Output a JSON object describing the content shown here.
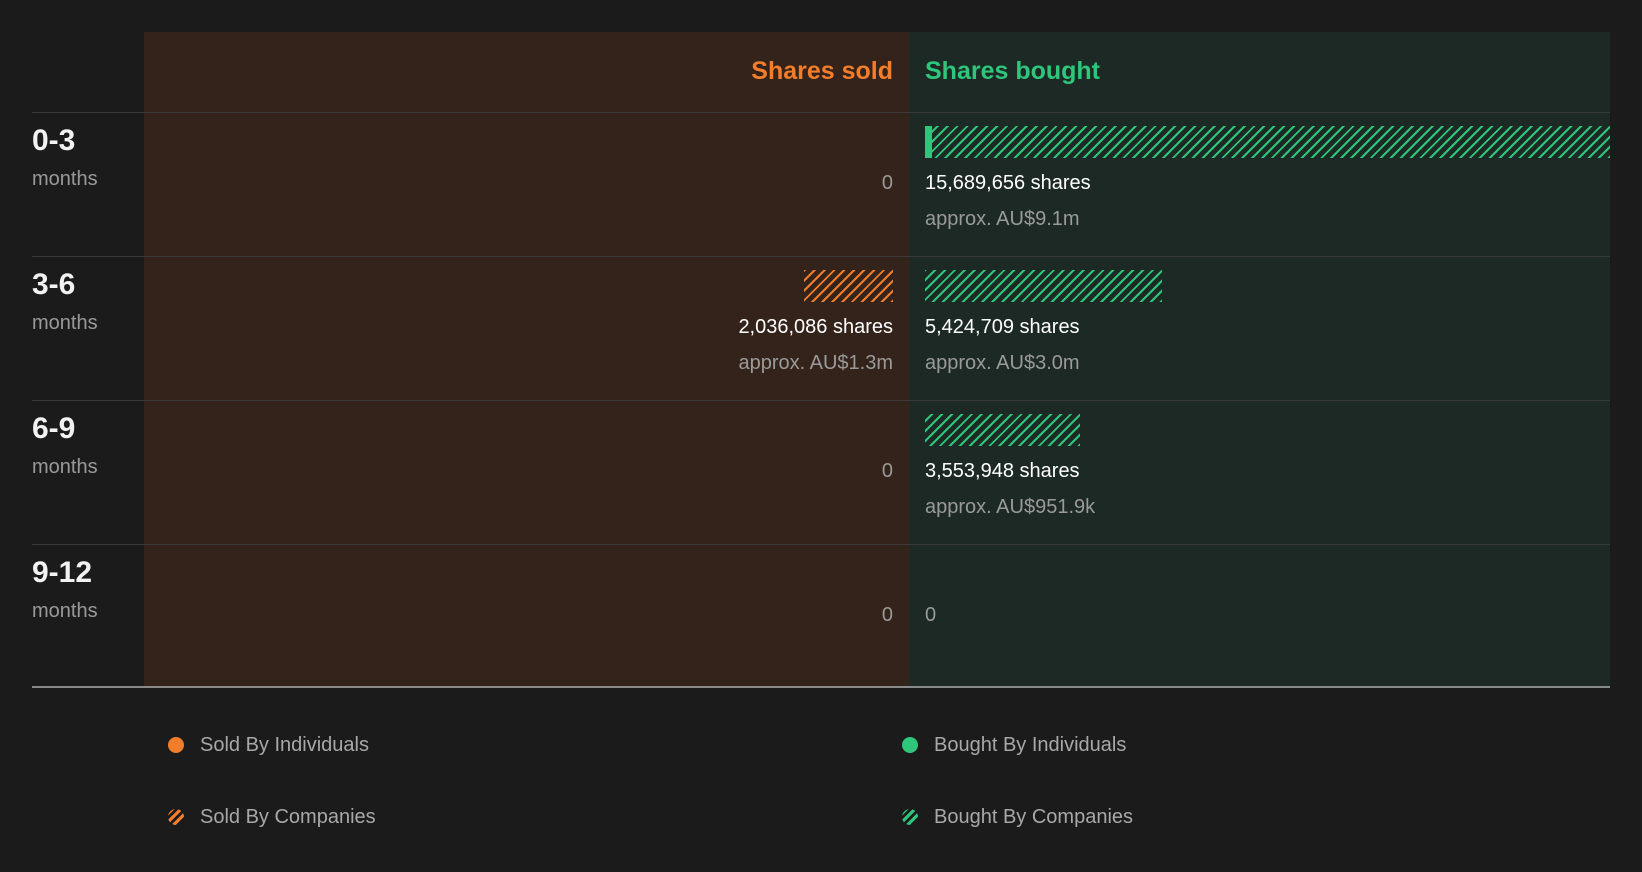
{
  "colors": {
    "sold": "#f27d2a",
    "bought": "#2ec67a",
    "sold_bg": "#33231b",
    "bought_bg": "#1c2924",
    "page_bg": "#1b1b1b"
  },
  "chart_data": {
    "type": "bar",
    "orientation": "horizontal-diverging",
    "headers": {
      "sold": "Shares sold",
      "bought": "Shares bought"
    },
    "categories": [
      {
        "range": "0-3",
        "unit": "months"
      },
      {
        "range": "3-6",
        "unit": "months"
      },
      {
        "range": "6-9",
        "unit": "months"
      },
      {
        "range": "9-12",
        "unit": "months"
      }
    ],
    "sold": [
      {
        "shares": 0,
        "label": "0",
        "approx": "",
        "individuals": 0,
        "companies": 0
      },
      {
        "shares": 2036086,
        "label": "2,036,086 shares",
        "approx": "approx. AU$1.3m",
        "individuals": 0,
        "companies": 2036086
      },
      {
        "shares": 0,
        "label": "0",
        "approx": "",
        "individuals": 0,
        "companies": 0
      },
      {
        "shares": 0,
        "label": "0",
        "approx": "",
        "individuals": 0,
        "companies": 0
      }
    ],
    "bought": [
      {
        "shares": 15689656,
        "label": "15,689,656 shares",
        "approx": "approx. AU$9.1m",
        "individuals": 160000,
        "companies": 15529656
      },
      {
        "shares": 5424709,
        "label": "5,424,709 shares",
        "approx": "approx. AU$3.0m",
        "individuals": 0,
        "companies": 5424709
      },
      {
        "shares": 3553948,
        "label": "3,553,948 shares",
        "approx": "approx. AU$951.9k",
        "individuals": 0,
        "companies": 3553948
      },
      {
        "shares": 0,
        "label": "0",
        "approx": "",
        "individuals": 0,
        "companies": 0
      }
    ],
    "legend": [
      {
        "key": "sold_individuals",
        "label": "Sold By Individuals",
        "style": "solid",
        "color": "#f27d2a"
      },
      {
        "key": "bought_individuals",
        "label": "Bought By Individuals",
        "style": "solid",
        "color": "#2ec67a"
      },
      {
        "key": "sold_companies",
        "label": "Sold By Companies",
        "style": "hatched",
        "color": "#f27d2a"
      },
      {
        "key": "bought_companies",
        "label": "Bought By Companies",
        "style": "hatched",
        "color": "#2ec67a"
      }
    ]
  }
}
